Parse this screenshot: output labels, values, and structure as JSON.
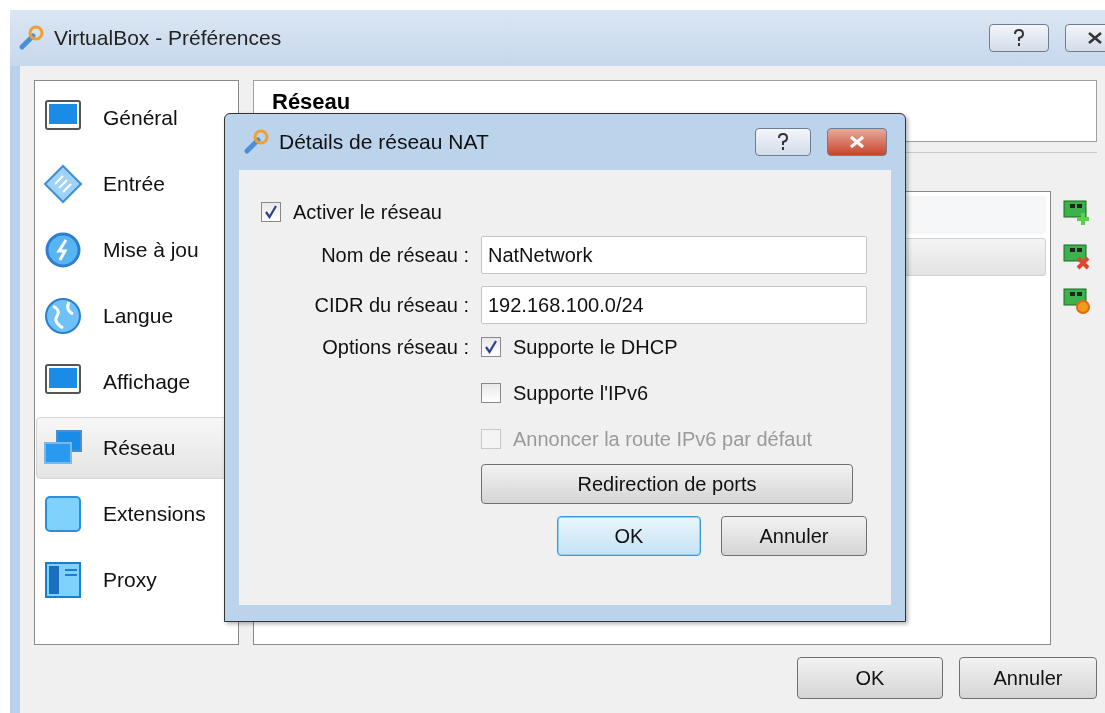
{
  "window": {
    "title": "VirtualBox - Préférences"
  },
  "sidebar": {
    "items": [
      {
        "label": "Général",
        "selected": false
      },
      {
        "label": "Entrée",
        "selected": false
      },
      {
        "label": "Mise à jou",
        "selected": false
      },
      {
        "label": "Langue",
        "selected": false
      },
      {
        "label": "Affichage",
        "selected": false
      },
      {
        "label": "Réseau",
        "selected": true
      },
      {
        "label": "Extensions",
        "selected": false
      },
      {
        "label": "Proxy",
        "selected": false
      }
    ]
  },
  "page": {
    "heading": "Réseau",
    "networks": [
      {
        "selected": false
      },
      {
        "selected": true
      }
    ]
  },
  "buttons": [
    {
      "label": "OK"
    },
    {
      "label": "Annuler"
    }
  ],
  "dialog": {
    "title": "Détails de réseau NAT",
    "enable": {
      "label": "Activer le réseau",
      "checked": true
    },
    "fields": [
      {
        "label": "Nom de réseau :",
        "value": "NatNetwork"
      },
      {
        "label": "CIDR du réseau :",
        "value": "192.168.100.0/24"
      }
    ],
    "options_label": "Options réseau :",
    "options": [
      {
        "label": "Supporte le DHCP",
        "checked": true,
        "disabled": false
      },
      {
        "label": "Supporte l'IPv6",
        "checked": false,
        "disabled": false
      },
      {
        "label": "Annoncer la route IPv6 par défaut",
        "checked": false,
        "disabled": true
      }
    ],
    "port_forwarding": "Redirection de ports",
    "buttons": [
      {
        "label": "OK",
        "default": true
      },
      {
        "label": "Annuler",
        "default": false
      }
    ]
  }
}
